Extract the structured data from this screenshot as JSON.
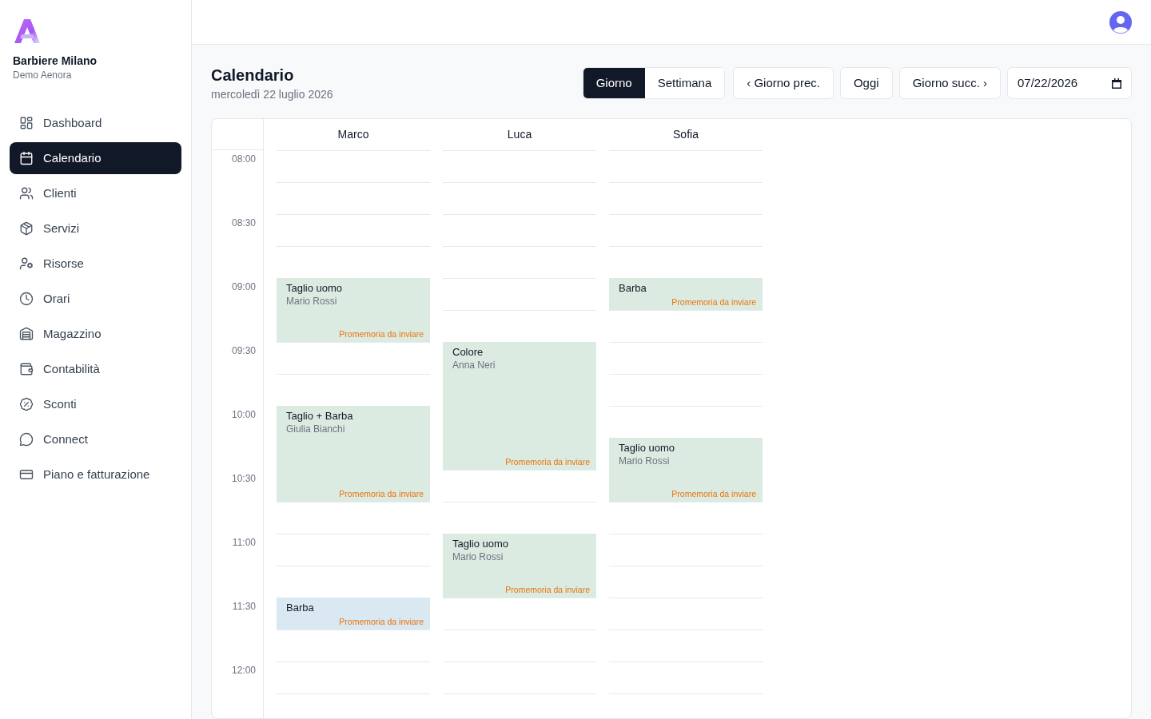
{
  "sidebar": {
    "brand": {
      "name": "Barbiere Milano",
      "subtitle": "Demo Aenora"
    },
    "items": [
      {
        "label": "Dashboard",
        "selected": false
      },
      {
        "label": "Calendario",
        "selected": true
      },
      {
        "label": "Clienti",
        "selected": false
      },
      {
        "label": "Servizi",
        "selected": false
      },
      {
        "label": "Risorse",
        "selected": false
      },
      {
        "label": "Orari",
        "selected": false
      },
      {
        "label": "Magazzino",
        "selected": false
      },
      {
        "label": "Contabilità",
        "selected": false
      },
      {
        "label": "Sconti",
        "selected": false
      },
      {
        "label": "Connect",
        "selected": false
      },
      {
        "label": "Piano e fatturazione",
        "selected": false
      }
    ]
  },
  "page": {
    "title": "Calendario",
    "subtitle": "mercoledì 22 luglio 2026"
  },
  "toolbar": {
    "views": [
      {
        "label": "Giorno",
        "selected": true
      },
      {
        "label": "Settimana",
        "selected": false
      }
    ],
    "buttons": [
      "‹ Giorno prec.",
      "Oggi",
      "Giorno succ. ›"
    ],
    "date": {
      "value": "07/22/2026"
    }
  },
  "calendar": {
    "time_labels": [
      "08:00",
      "08:30",
      "09:00",
      "09:30",
      "10:00",
      "10:30",
      "11:00",
      "11:30",
      "12:00"
    ],
    "columns": [
      {
        "name": "Marco",
        "slots": [
          {
            "kind": "free"
          },
          {
            "kind": "free"
          },
          {
            "kind": "free"
          },
          {
            "kind": "free"
          },
          {
            "kind": "appointment",
            "title": "Taglio uomo",
            "client": "Mario Rossi",
            "reminder": "Promemoria da inviare",
            "color": "#dcebe1"
          },
          {
            "kind": "continued"
          },
          {
            "kind": "free"
          },
          {
            "kind": "free"
          },
          {
            "kind": "appointment",
            "title": "Taglio + Barba",
            "client": "Giulia Bianchi",
            "reminder": "Promemoria da inviare",
            "color": "#dcebe1"
          },
          {
            "kind": "continued"
          },
          {
            "kind": "continued"
          },
          {
            "kind": "free"
          },
          {
            "kind": "free"
          },
          {
            "kind": "free"
          },
          {
            "kind": "appointment",
            "title": "Barba",
            "reminder": "Promemoria da inviare",
            "color": "#dae8f1"
          },
          {
            "kind": "free"
          },
          {
            "kind": "free"
          },
          {
            "kind": "free"
          }
        ]
      },
      {
        "name": "Luca",
        "slots": [
          {
            "kind": "free"
          },
          {
            "kind": "free"
          },
          {
            "kind": "free"
          },
          {
            "kind": "free"
          },
          {
            "kind": "free"
          },
          {
            "kind": "free"
          },
          {
            "kind": "appointment",
            "title": "Colore",
            "client": "Anna Neri",
            "reminder": "Promemoria da inviare",
            "color": "#dcebe1"
          },
          {
            "kind": "continued"
          },
          {
            "kind": "continued"
          },
          {
            "kind": "continued"
          },
          {
            "kind": "free"
          },
          {
            "kind": "free"
          },
          {
            "kind": "appointment",
            "title": "Taglio uomo",
            "client": "Mario Rossi",
            "reminder": "Promemoria da inviare",
            "color": "#dcebe1"
          },
          {
            "kind": "continued"
          },
          {
            "kind": "free"
          },
          {
            "kind": "free"
          },
          {
            "kind": "free"
          },
          {
            "kind": "free"
          }
        ]
      },
      {
        "name": "Sofia",
        "slots": [
          {
            "kind": "free"
          },
          {
            "kind": "free"
          },
          {
            "kind": "free"
          },
          {
            "kind": "free"
          },
          {
            "kind": "appointment",
            "title": "Barba",
            "reminder": "Promemoria da inviare",
            "color": "#dcebe1"
          },
          {
            "kind": "free"
          },
          {
            "kind": "free"
          },
          {
            "kind": "free"
          },
          {
            "kind": "free"
          },
          {
            "kind": "appointment",
            "title": "Taglio uomo",
            "client": "Mario Rossi",
            "reminder": "Promemoria da inviare",
            "color": "#dcebe1"
          },
          {
            "kind": "continued"
          },
          {
            "kind": "free"
          },
          {
            "kind": "free"
          },
          {
            "kind": "free"
          },
          {
            "kind": "free"
          },
          {
            "kind": "free"
          },
          {
            "kind": "free"
          },
          {
            "kind": "free"
          }
        ]
      }
    ]
  }
}
